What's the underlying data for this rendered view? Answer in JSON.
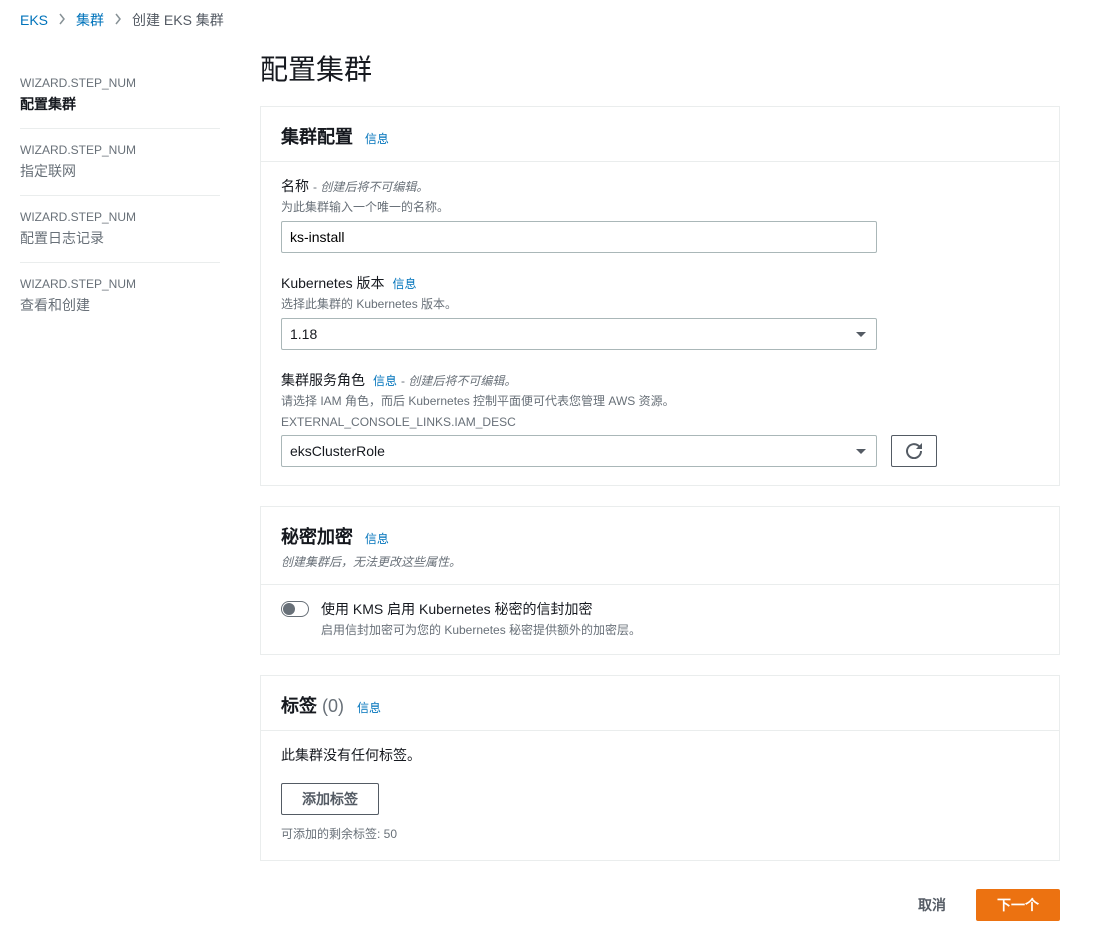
{
  "breadcrumb": {
    "root": "EKS",
    "cluster": "集群",
    "current": "创建 EKS 集群"
  },
  "wizard": {
    "step_num_label": "WIZARD.STEP_NUM",
    "steps": [
      {
        "title": "配置集群",
        "active": true
      },
      {
        "title": "指定联网",
        "active": false
      },
      {
        "title": "配置日志记录",
        "active": false
      },
      {
        "title": "查看和创建",
        "active": false
      }
    ]
  },
  "pageTitle": "配置集群",
  "infoText": "信息",
  "clusterConfig": {
    "title": "集群配置",
    "name": {
      "label": "名称",
      "hint": "创建后将不可编辑。",
      "desc": "为此集群输入一个唯一的名称。",
      "value": "ks-install"
    },
    "k8sVersion": {
      "label": "Kubernetes 版本",
      "desc": "选择此集群的 Kubernetes 版本。",
      "value": "1.18"
    },
    "serviceRole": {
      "label": "集群服务角色",
      "hint": "创建后将不可编辑。",
      "desc": "请选择 IAM 角色，而后 Kubernetes 控制平面便可代表您管理 AWS 资源。",
      "extra": "EXTERNAL_CONSOLE_LINKS.IAM_DESC",
      "value": "eksClusterRole"
    }
  },
  "secrets": {
    "title": "秘密加密",
    "desc": "创建集群后，无法更改这些属性。",
    "toggleLabel": "使用 KMS 启用 Kubernetes 秘密的信封加密",
    "toggleDesc": "启用信封加密可为您的 Kubernetes 秘密提供额外的加密层。"
  },
  "tags": {
    "title": "标签",
    "count": "(0)",
    "empty": "此集群没有任何标签。",
    "addBtn": "添加标签",
    "remaining": "可添加的剩余标签: 50"
  },
  "footer": {
    "cancel": "取消",
    "next": "下一个"
  }
}
